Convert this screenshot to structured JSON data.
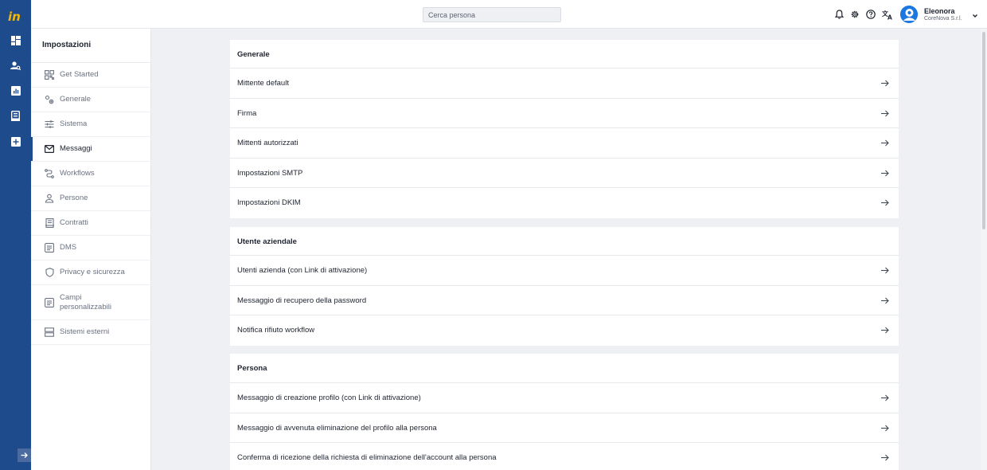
{
  "header": {
    "search_placeholder": "Cerca persona",
    "user_name": "Eleonora",
    "user_company": "CoreNova S.r.l."
  },
  "rail": {
    "icons": [
      "logo-icon",
      "dashboard-icon",
      "people-search-icon",
      "reports-icon",
      "documents-icon",
      "add-icon",
      "expand-sidebar-icon"
    ]
  },
  "sidebar": {
    "title": "Impostazioni",
    "items": [
      {
        "label": "Get Started",
        "icon": "qr-grid-icon"
      },
      {
        "label": "Generale",
        "icon": "gears-icon"
      },
      {
        "label": "Sistema",
        "icon": "sliders-icon"
      },
      {
        "label": "Messaggi",
        "icon": "mail-icon",
        "active": true
      },
      {
        "label": "Workflows",
        "icon": "route-icon"
      },
      {
        "label": "Persone",
        "icon": "person-icon"
      },
      {
        "label": "Contratti",
        "icon": "contract-icon"
      },
      {
        "label": "DMS",
        "icon": "document-icon"
      },
      {
        "label": "Privacy e sicurezza",
        "icon": "shield-icon"
      },
      {
        "label": "Campi personalizzabili",
        "icon": "form-icon"
      },
      {
        "label": "Sistemi esterni",
        "icon": "server-icon"
      }
    ]
  },
  "sections": [
    {
      "title": "Generale",
      "rows": [
        "Mittente default",
        "Firma",
        "Mittenti autorizzati",
        "Impostazioni SMTP",
        "Impostazioni DKIM"
      ]
    },
    {
      "title": "Utente aziendale",
      "rows": [
        "Utenti azienda (con Link di attivazione)",
        "Messaggio di recupero della password",
        "Notifica rifiuto workflow"
      ]
    },
    {
      "title": "Persona",
      "rows": [
        "Messaggio di creazione profilo (con Link di attivazione)",
        "Messaggio di avvenuta eliminazione del profilo alla persona",
        "Conferma di ricezione della richiesta di eliminazione dell'account alla persona"
      ]
    }
  ],
  "colors": {
    "rail": "#1e4b8c",
    "accent": "#1a78e0",
    "logo": "#f2b705",
    "background": "#eef0f3"
  }
}
